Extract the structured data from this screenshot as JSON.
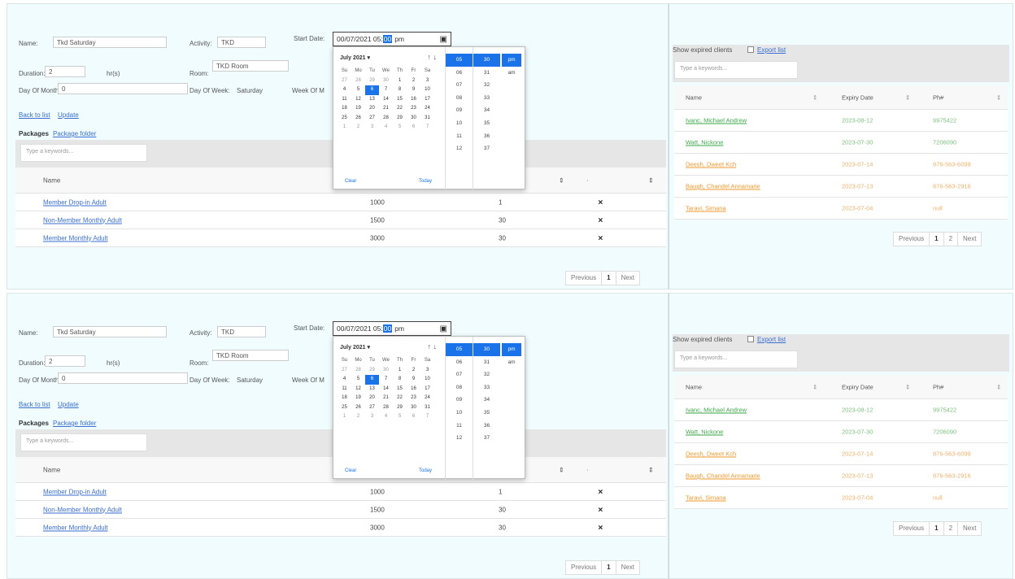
{
  "form": {
    "name_label": "Name:",
    "name_value": "Tkd Saturday",
    "activity_label": "Activity:",
    "activity_value": "TKD",
    "start_date_label": "Start Date:",
    "start_date_prefix": "00/07/2021 05:",
    "start_date_selected": "00",
    "start_date_suffix": "pm",
    "duration_label": "Duration:",
    "duration_value": "2",
    "duration_unit": "hr(s)",
    "room_label": "Room:",
    "room_value": "TKD Room",
    "day_of_month_label": "Day Of Month:",
    "day_of_month_value": "0",
    "day_of_week_label": "Day Of Week:",
    "day_of_week_value": "Saturday",
    "week_of_month_label": "Week Of M"
  },
  "links": {
    "back_to_list": "Back to list",
    "update": "Update"
  },
  "packages": {
    "title": "Packages",
    "package_folder_link": "Package folder",
    "search_placeholder": "Type a keywords...",
    "columns": [
      "Name",
      "",
      "",
      "",
      ""
    ],
    "rows": [
      {
        "name": "Member Drop-in Adult",
        "price": "1000",
        "qty": "1"
      },
      {
        "name": "Non-Member Monthly Adult",
        "price": "1500",
        "qty": "30"
      },
      {
        "name": "Member Monthly Adult",
        "price": "3000",
        "qty": "30"
      }
    ],
    "remove_icon": "x-icon",
    "pager": {
      "previous": "Previous",
      "page": "1",
      "next": "Next"
    }
  },
  "datepicker": {
    "month_label": "July 2021 ▾",
    "weekday_headers": [
      "Su",
      "Mo",
      "Tu",
      "We",
      "Th",
      "Fr",
      "Sa"
    ],
    "weeks": [
      [
        "27",
        "28",
        "29",
        "30",
        "1",
        "2",
        "3"
      ],
      [
        "4",
        "5",
        "6",
        "7",
        "8",
        "9",
        "10"
      ],
      [
        "11",
        "12",
        "13",
        "14",
        "15",
        "16",
        "17"
      ],
      [
        "18",
        "19",
        "20",
        "21",
        "22",
        "23",
        "24"
      ],
      [
        "25",
        "26",
        "27",
        "28",
        "29",
        "30",
        "31"
      ],
      [
        "1",
        "2",
        "3",
        "4",
        "5",
        "6",
        "7"
      ]
    ],
    "selected_day": "6",
    "clear": "Clear",
    "today": "Today",
    "hours": [
      "05",
      "06",
      "07",
      "08",
      "09",
      "10",
      "11",
      "12"
    ],
    "minutes": [
      "30",
      "31",
      "32",
      "33",
      "34",
      "35",
      "36",
      "37"
    ],
    "ampm": [
      "pm",
      "am"
    ]
  },
  "clients": {
    "show_expired_label": "Show expired clients",
    "export_list": "Export list",
    "search_placeholder": "Type a keywords...",
    "col_name": "Name",
    "col_expiry": "Expiry Date",
    "col_phone": "Ph#",
    "rows": [
      {
        "name": "Ivanc, Michael Andrew",
        "expiry": "2023-08-12",
        "phone": "9975422",
        "status": "green"
      },
      {
        "name": "Watt, Nickone",
        "expiry": "2023-07-30",
        "phone": "7206090",
        "status": "green"
      },
      {
        "name": "Deesh, Dweet Kch",
        "expiry": "2023-07-14",
        "phone": "876-563-6099",
        "status": "orange"
      },
      {
        "name": "Baugh, Chandel Annamarie",
        "expiry": "2023-07-13",
        "phone": "876-563-2916",
        "status": "orange"
      },
      {
        "name": "Taravi, Simana",
        "expiry": "2023-07-04",
        "phone": "null",
        "status": "orange"
      }
    ],
    "pager": {
      "previous": "Previous",
      "page1": "1",
      "page2": "2",
      "next": "Next"
    }
  },
  "colors": {
    "accent": "#1a73e8",
    "panel_bg": "#f0fcfe",
    "link": "#3b6fd0",
    "active_green": "#3ea84a",
    "expiring_orange": "#f0982c"
  }
}
